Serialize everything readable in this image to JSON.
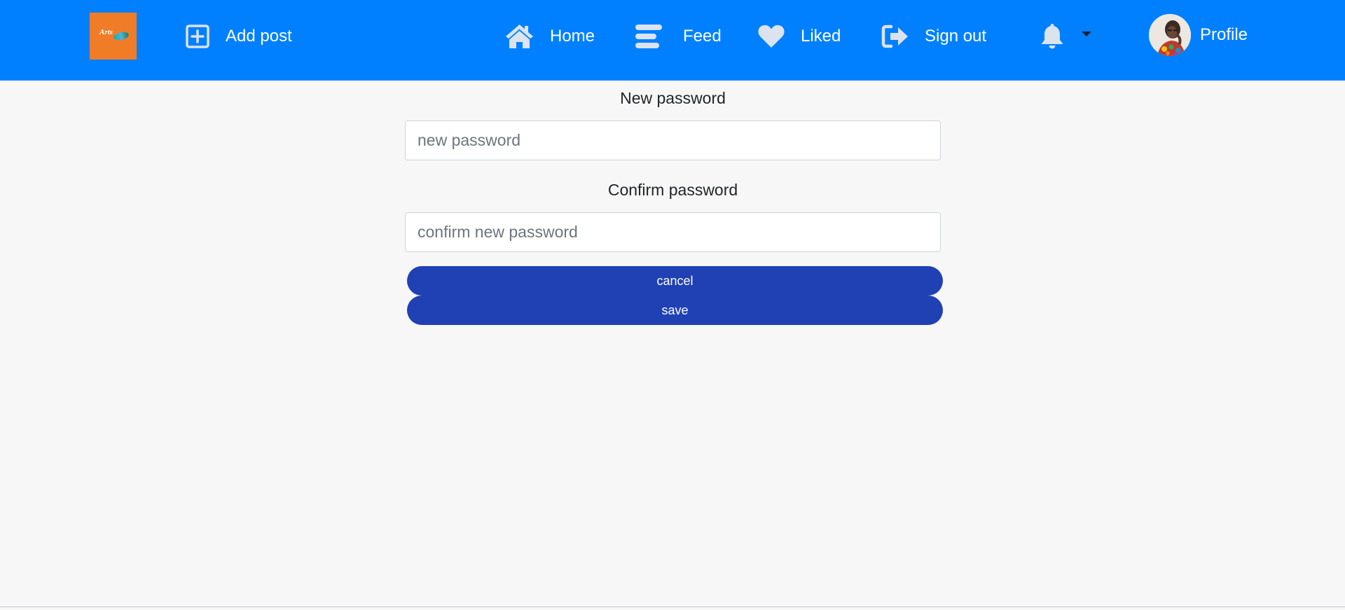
{
  "nav": {
    "logo_text": "Arts",
    "add_post": "Add post",
    "home": "Home",
    "feed": "Feed",
    "liked": "Liked",
    "sign_out": "Sign out",
    "profile": "Profile"
  },
  "form": {
    "new_password_label": "New password",
    "new_password_placeholder": "new password",
    "confirm_password_label": "Confirm password",
    "confirm_password_placeholder": "confirm new password",
    "cancel_label": "cancel",
    "save_label": "save"
  },
  "colors": {
    "navbar": "#0080ff",
    "nav_icon": "#dbe3ee",
    "button": "#2041b4",
    "page_background": "#f7f7f7",
    "logo": "#f07c28"
  },
  "icons": {
    "add_post": "plus-square-icon",
    "home": "home-icon",
    "feed": "feed-lines-icon",
    "liked": "heart-icon",
    "sign_out": "sign-out-icon",
    "notifications": "bell-icon",
    "dropdown": "caret-down-icon"
  }
}
